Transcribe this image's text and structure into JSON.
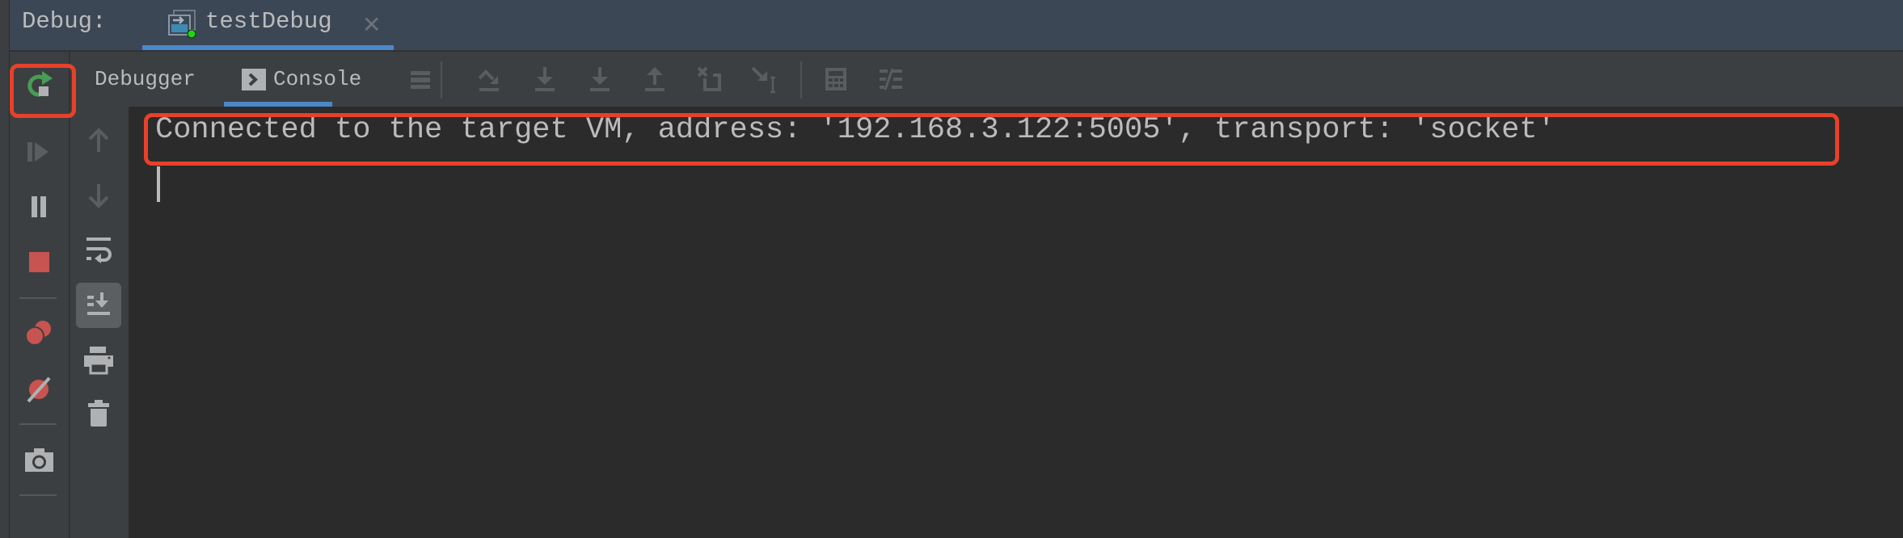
{
  "window": {
    "title_label": "Debug:",
    "session_tab": {
      "label": "testDebug",
      "icon": "debug-session-icon",
      "status": "running"
    }
  },
  "toolbar": {
    "tabs": [
      {
        "label": "Debugger",
        "active": false
      },
      {
        "label": "Console",
        "active": true,
        "icon": "console-icon"
      }
    ],
    "buttons": [
      "layout-list-icon",
      "show-execution-point-icon",
      "step-over-icon",
      "step-into-icon",
      "force-step-into-icon",
      "step-out-icon",
      "drop-frame-icon",
      "run-to-cursor-icon",
      "evaluate-expression-icon",
      "trace-current-stream-icon"
    ]
  },
  "left_toolbar": {
    "buttons": [
      "rerun-icon",
      "resume-icon",
      "pause-icon",
      "stop-icon",
      "view-breakpoints-icon",
      "mute-breakpoints-icon",
      "camera-icon"
    ]
  },
  "console_toolbar": {
    "buttons": [
      "up-arrow-icon",
      "down-arrow-icon",
      "soft-wrap-icon",
      "scroll-to-end-icon",
      "print-icon",
      "clear-all-icon"
    ]
  },
  "console": {
    "lines": [
      "Connected to the target VM, address: '192.168.3.122:5005', transport: 'socket'"
    ]
  },
  "colors": {
    "accent": "#4a88c7",
    "highlight": "#e8402a",
    "stop": "#c75450",
    "rerun": "#499c54",
    "status_dot": "#23d50f"
  }
}
